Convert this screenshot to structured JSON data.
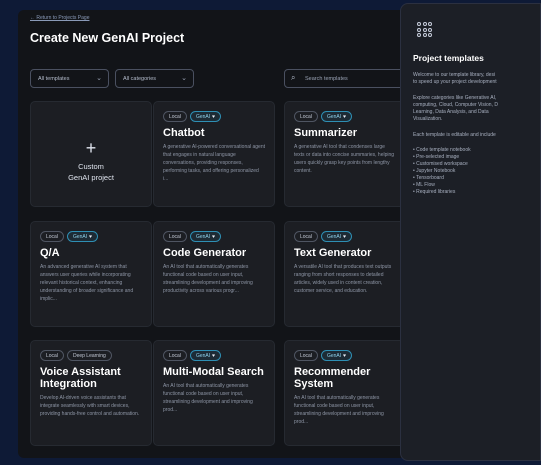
{
  "nav": {
    "back_link": "← Return to Projects Page"
  },
  "page_title": "Create New GenAI Project",
  "filters": {
    "templates": "All templates",
    "categories": "All categories"
  },
  "search": {
    "placeholder": "Search templates"
  },
  "custom_card": {
    "line1": "Custom",
    "line2": "GenAI project"
  },
  "cards": [
    {
      "badges": [
        "Local",
        "GenAI"
      ],
      "title": "Chatbot",
      "desc": "A generative AI-powered conversational agent that engages in natural language conversations, providing responses, performing tasks, and offering personalized i..."
    },
    {
      "badges": [
        "Local",
        "GenAI"
      ],
      "title": "Summarizer",
      "desc": "A generative AI tool that condenses large texts or data into concise summaries, helping users quickly grasp key points from lengthy content."
    },
    {
      "badges": [
        "Local",
        "GenAI"
      ],
      "title": "Q/A",
      "desc": "An advanced generative AI system that answers user queries while incorporating relevant historical context, enhancing understanding of broader significance and implic..."
    },
    {
      "badges": [
        "Local",
        "GenAI"
      ],
      "title": "Code Generator",
      "desc": "An AI tool that automatically generates functional code based on user input, streamlining development and improving productivity across various progr..."
    },
    {
      "badges": [
        "Local",
        "GenAI"
      ],
      "title": "Text Generator",
      "desc": "A versatile AI tool that produces text outputs ranging from short responses to detailed articles, widely used in content creation, customer service, and education."
    },
    {
      "badges": [
        "Local",
        "Deep Learning"
      ],
      "title": "Voice Assistant Integration",
      "desc": "Develop AI-driven voice assistants that integrate seamlessly with smart devices, providing hands-free control and automation."
    },
    {
      "badges": [
        "Local",
        "GenAI"
      ],
      "title": "Multi-Modal Search",
      "desc": "An AI tool that automatically generates functional code based on user input, streamlining development and improving prod..."
    },
    {
      "badges": [
        "Local",
        "GenAI"
      ],
      "title": "Recommender System",
      "desc": "An AI tool that automatically generates functional code based on user input, streamlining development and improving prod..."
    }
  ],
  "panel": {
    "title": "Project templates",
    "intro": [
      "Welcome to our template library, desi",
      "to speed up your project development"
    ],
    "categories": [
      "Explore categories like Generative AI,",
      "computing, Cloud, Computer Vision, D",
      "Learning, Data Analysis, and Data",
      "Visualization."
    ],
    "includes": "Each template is editable and include",
    "items": [
      "Code template notebook",
      "Pre-selected image",
      "Customised workspace",
      "Jupyter Notebook",
      "Tensorboard",
      "ML Flow",
      "Required libraries"
    ]
  },
  "colors": {
    "accent": "#2e8fb4",
    "background": "#0e1a36",
    "surface": "#1c1e23"
  }
}
